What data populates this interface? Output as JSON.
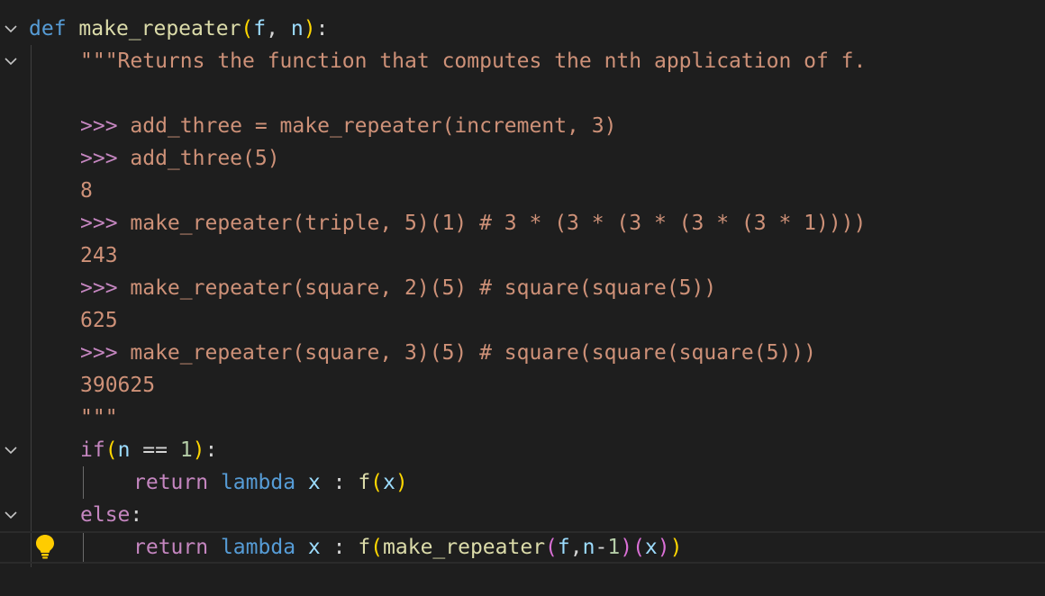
{
  "editor": {
    "lines": [
      {
        "def": "def",
        "name": "make_repeater",
        "open": "(",
        "p1": "f",
        "comma": ", ",
        "p2": "n",
        "close": ")",
        "colon": ":"
      },
      {
        "doc": "\"\"\"Returns the function that computes the nth application of f."
      },
      {},
      {
        "prompt": ">>>",
        "text": " add_three = make_repeater(increment, 3)"
      },
      {
        "prompt": ">>>",
        "text": " add_three(5)"
      },
      {
        "text": "8"
      },
      {
        "prompt": ">>>",
        "text": " make_repeater(triple, 5)(1) # 3 * (3 * (3 * (3 * (3 * 1))))"
      },
      {
        "text": "243"
      },
      {
        "prompt": ">>>",
        "text": " make_repeater(square, 2)(5) # square(square(5))"
      },
      {
        "text": "625"
      },
      {
        "prompt": ">>>",
        "text": " make_repeater(square, 3)(5) # square(square(square(5)))"
      },
      {
        "text": "390625"
      },
      {
        "text": "\"\"\""
      },
      {
        "kw": "if",
        "open": "(",
        "var": "n",
        "op": " == ",
        "num": "1",
        "close": ")",
        "colon": ":"
      },
      {
        "ret": "return",
        "lam": "lambda",
        "x": "x",
        "sep": " : ",
        "fn": "f",
        "open": "(",
        "arg": "x",
        "close": ")"
      },
      {
        "kw": "else",
        "colon": ":"
      },
      {
        "ret": "return",
        "lam": "lambda",
        "x": "x",
        "sep": " : ",
        "fn": "f",
        "open": "(",
        "inner_fn": "make_repeater",
        "open2": "(",
        "f": "f",
        "comma": ",",
        "n": "n",
        "minus": "-",
        "one": "1",
        "close2": ")",
        "open3": "(",
        "arg": "x",
        "close3": ")",
        "close": ")"
      }
    ]
  },
  "colors": {
    "background": "#1e1e1e",
    "keyword_def": "#569cd6",
    "keyword_control": "#c586c0",
    "function": "#dcdcaa",
    "parameter": "#9cdcfe",
    "string": "#ce9178",
    "number": "#b5cea8",
    "bracket_1": "#ffd700",
    "bracket_2": "#da70d6"
  },
  "icons": {
    "fold": "chevron-down-icon",
    "hint": "lightbulb-icon"
  }
}
